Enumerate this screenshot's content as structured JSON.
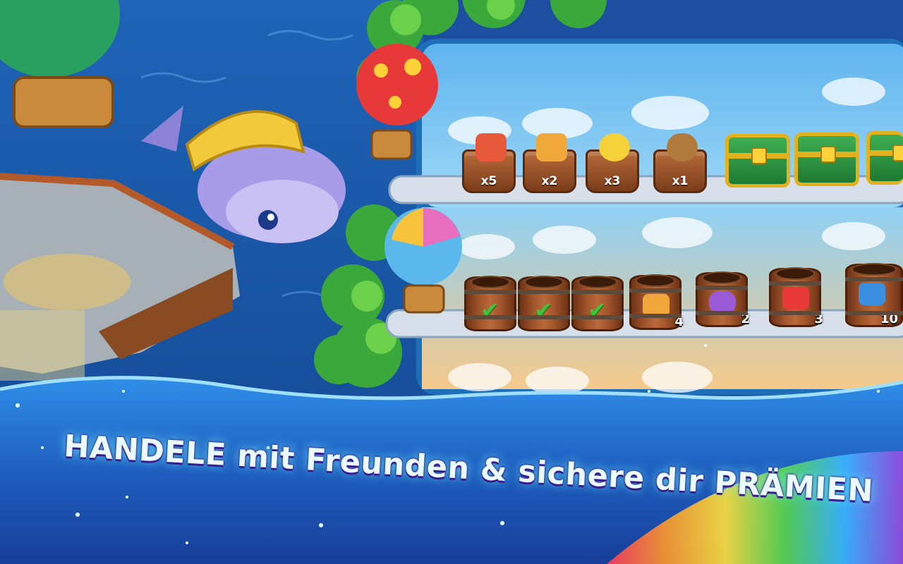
{
  "headline": "HANDELE mit Freunden & sichere dir PRÄMIEN",
  "order_shelf": {
    "crates": [
      {
        "label": "x5",
        "icon": "gem-bundle-icon",
        "color": "#e8583a"
      },
      {
        "label": "x2",
        "icon": "crystal-ore-icon",
        "color": "#f1a83a"
      },
      {
        "label": "x3",
        "icon": "potion-jar-icon",
        "color": "#f5d23a"
      },
      {
        "label": "x1",
        "icon": "wood-log-icon",
        "color": "#b07a3c"
      }
    ],
    "chests": [
      "chest-icon",
      "chest-icon",
      "chest-icon"
    ]
  },
  "delivery_shelf": {
    "barrels": [
      {
        "status": "done",
        "icon": "check-icon",
        "count": ""
      },
      {
        "status": "done",
        "icon": "check-icon",
        "count": ""
      },
      {
        "status": "done",
        "icon": "check-icon",
        "count": ""
      },
      {
        "status": "pending",
        "icon": "cheese-icon",
        "count": "4",
        "color": "#f0a63a"
      },
      {
        "status": "pending",
        "icon": "jam-jar-icon",
        "count": "2",
        "color": "#9b5ad6"
      },
      {
        "status": "pending",
        "icon": "popcorn-icon",
        "count": "3",
        "color": "#e83a3a"
      },
      {
        "status": "pending",
        "icon": "blue-fabric-icon",
        "count": "10",
        "color": "#3a8fe0"
      }
    ]
  },
  "colors": {
    "ocean_deep": "#1a5aa8",
    "panel_sky": "#74c9f2",
    "shelf": "#e0e8f0",
    "headline_glow": "#6af0ff"
  }
}
